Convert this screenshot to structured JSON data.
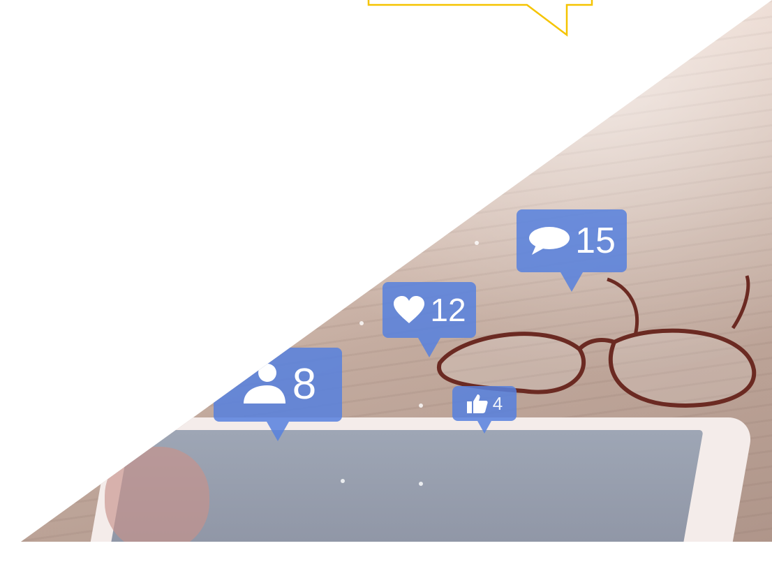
{
  "badges": {
    "comments": {
      "icon": "speech-bubble-icon",
      "count": "15"
    },
    "hearts": {
      "icon": "heart-icon",
      "count": "12"
    },
    "followers": {
      "icon": "person-icon",
      "count": "8"
    },
    "likes": {
      "icon": "thumbs-up-icon",
      "count": "4"
    }
  },
  "colors": {
    "badge_blue": "#5680DE",
    "accent_yellow": "#F5C400",
    "background": "#FFFFFF"
  }
}
